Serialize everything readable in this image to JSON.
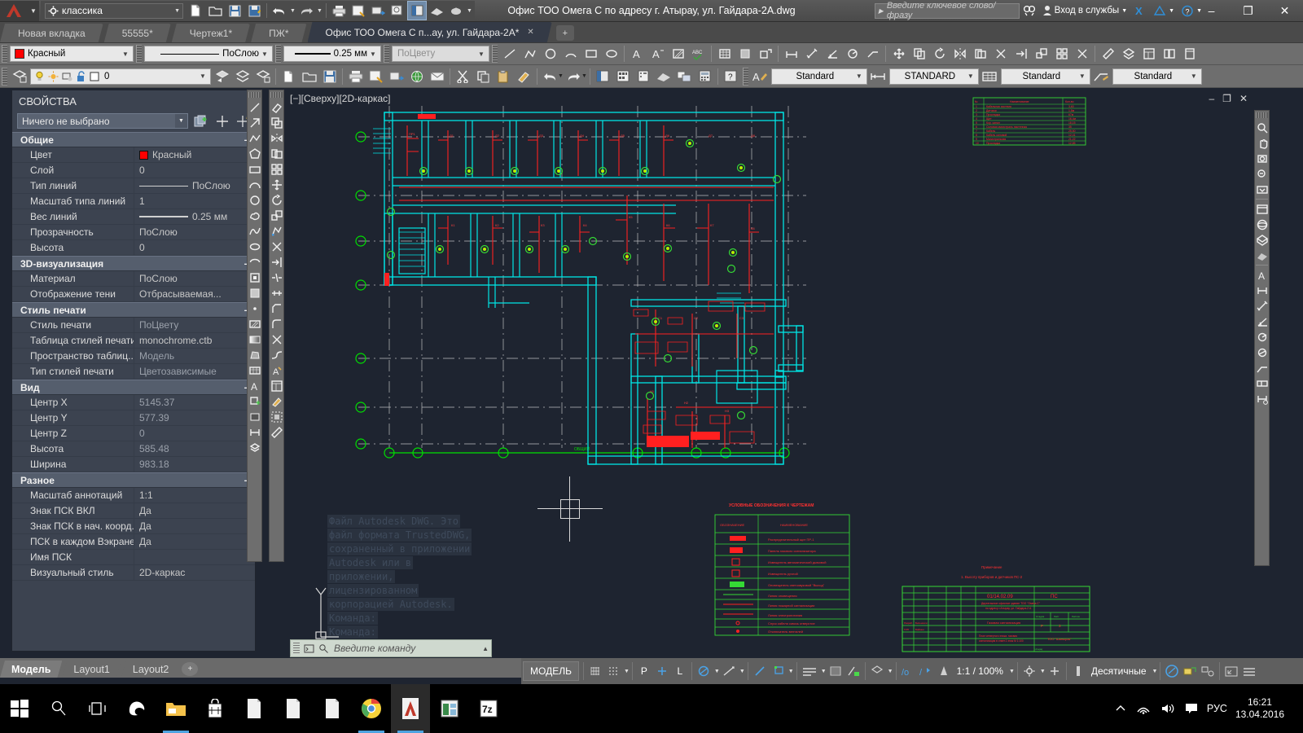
{
  "titlebar": {
    "workspace": "классика",
    "document_title": "Офис ТОО Омега С по адресу г. Атырау, ул. Гайдара-2A.dwg",
    "search_placeholder": "Введите ключевое слово/фразу",
    "signin_label": "Вход в службы",
    "min_glyph": "–",
    "restore_glyph": "❐",
    "close_glyph": "✕"
  },
  "file_tabs": [
    {
      "label": "Новая вкладка",
      "active": false
    },
    {
      "label": "55555*",
      "active": false
    },
    {
      "label": "Чертеж1*",
      "active": false
    },
    {
      "label": "ПЖ*",
      "active": false
    },
    {
      "label": "Офис ТОО Омега С п...ау, ул. Гайдара-2A*",
      "active": true
    }
  ],
  "file_tab_add": "+",
  "toolbar_row1": {
    "color_combo": {
      "value": "Красный",
      "swatch": "#ff0000"
    },
    "linetype_combo": {
      "value": "ПоСлою"
    },
    "lineweight_combo": {
      "value": "0.25 мм"
    },
    "plotstyle_combo": {
      "value": "ПоЦвету"
    }
  },
  "toolbar_row2": {
    "layer_combo": {
      "value": "0"
    },
    "textstyle_combo": {
      "value": "Standard"
    },
    "dimstyle_combo": {
      "value": "STANDARD"
    },
    "tablestyle_combo": {
      "value": "Standard"
    },
    "mleaderstyle_combo": {
      "value": "Standard"
    }
  },
  "properties": {
    "title": "СВОЙСТВА",
    "selection": "Ничего не выбрано",
    "groups": [
      {
        "name": "Общие",
        "collapse": "–",
        "rows": [
          {
            "key": "Цвет",
            "value": "Красный",
            "swatch": "#ff0000",
            "gray": false
          },
          {
            "key": "Слой",
            "value": "0",
            "gray": false
          },
          {
            "key": "Тип линий",
            "value": "ПоСлою",
            "line": "thin",
            "gray": false
          },
          {
            "key": "Масштаб типа линий",
            "value": "1",
            "gray": false
          },
          {
            "key": "Вес линий",
            "value": "0.25 мм",
            "line": "thick",
            "gray": false
          },
          {
            "key": "Прозрачность",
            "value": "ПоСлою",
            "gray": false
          },
          {
            "key": "Высота",
            "value": "0",
            "gray": false
          }
        ]
      },
      {
        "name": "3D-визуализация",
        "collapse": "–",
        "rows": [
          {
            "key": "Материал",
            "value": "ПоСлою",
            "gray": false
          },
          {
            "key": "Отображение тени",
            "value": "Отбрасываемая...",
            "gray": false
          }
        ]
      },
      {
        "name": "Стиль печати",
        "collapse": "–",
        "rows": [
          {
            "key": "Стиль печати",
            "value": "ПоЦвету",
            "gray": true
          },
          {
            "key": "Таблица стилей печати",
            "value": "monochrome.ctb",
            "gray": false
          },
          {
            "key": "Пространство  таблиц...",
            "value": "Модель",
            "gray": true
          },
          {
            "key": "Тип стилей печати",
            "value": "Цветозависимые",
            "gray": true
          }
        ]
      },
      {
        "name": "Вид",
        "collapse": "–",
        "rows": [
          {
            "key": "Центр X",
            "value": "5145.37",
            "gray": true
          },
          {
            "key": "Центр Y",
            "value": "577.39",
            "gray": true
          },
          {
            "key": "Центр Z",
            "value": "0",
            "gray": true
          },
          {
            "key": "Высота",
            "value": "585.48",
            "gray": true
          },
          {
            "key": "Ширина",
            "value": "983.18",
            "gray": true
          }
        ]
      },
      {
        "name": "Разное",
        "collapse": "–",
        "rows": [
          {
            "key": "Масштаб аннотаций",
            "value": "1:1",
            "gray": false
          },
          {
            "key": "Знак ПСК ВКЛ",
            "value": "Да",
            "gray": false
          },
          {
            "key": "Знак ПСК в нач. коорд.",
            "value": "Да",
            "gray": false
          },
          {
            "key": "ПСК в каждом Вэкране",
            "value": "Да",
            "gray": false
          },
          {
            "key": "Имя ПСК",
            "value": "",
            "gray": false
          },
          {
            "key": "Визуальный стиль",
            "value": "2D-каркас",
            "gray": false
          }
        ]
      }
    ]
  },
  "canvas": {
    "viewport_label": "[−][Сверху][2D-каркас]",
    "command_history": [
      "Файл Autodesk DWG. Это",
      "файл формата TrustedDWG,",
      "сохраненный в приложении",
      "Autodesk или в",
      "приложении,",
      "лицензированном",
      "корпорацией Autodesk.",
      "Команда:",
      "Команда:"
    ],
    "ucs_y_label": "Y",
    "drawing_legend_title": "УСЛОВНЫЕ ОБОЗНАЧЕНИЯ К ЧЕРТЕЖАМ",
    "drawing_legend_headers": [
      "ОБОЗНАЧЕНИЕ",
      "НАИМЕНОВАНИЕ"
    ],
    "drawing_legend_rows": [
      "Распределительный щит ПР-1",
      "Панель газового сигнализатора",
      "Извещатель автоматический дымовой",
      "Извещатель ручной",
      "Оповещатель светозвуковой \"Выход\"",
      "Линия оповещения",
      "Линия пожарной сигнализации",
      "Линия электропитания",
      "Спуск кабеля сквозь отверстие",
      "Отключатель вентилей",
      "Извещатель автоматический тепловой"
    ],
    "title_block": {
      "code": "01/14.02.09",
      "stage": "ПС",
      "org": "Двухэтажное офисное здание ТОО \"Омега С\"",
      "addr": "по адресу г.Атырау, ул. Гайдара-2 А",
      "section": "Газовая сигнализация",
      "stage_label": "Стадия",
      "sheet_label": "Лист",
      "sheets_label": "Листов",
      "stage_val": "Р",
      "sheet_val": "3",
      "company": "ТОО \"Шанырак\"",
      "note_title": "Примечание",
      "note_1": "1. Высоту приборов и датчиков ПС-2"
    }
  },
  "command_line": {
    "placeholder": "Введите  команду"
  },
  "model_tabs": [
    {
      "label": "Модель",
      "active": true
    },
    {
      "label": "Layout1",
      "active": false
    },
    {
      "label": "Layout2",
      "active": false
    }
  ],
  "model_tab_add": "+",
  "statusbar": {
    "model_label": "МОДЕЛЬ",
    "ortho_label": "P",
    "polar_label": "L",
    "annotation_scale": "1:1 / 100%",
    "units": "Десятичные"
  },
  "taskbar": {
    "items": [
      "start-icon",
      "search-icon",
      "taskview-icon",
      "edge-icon",
      "explorer-icon",
      "store-icon",
      "doc1-icon",
      "doc2-icon",
      "doc3-icon",
      "chrome-icon",
      "autocad-icon",
      "excel-icon",
      "sevenzip-icon"
    ],
    "tray": {
      "language": "РУС",
      "time": "16:21",
      "date": "13.04.2016"
    }
  }
}
